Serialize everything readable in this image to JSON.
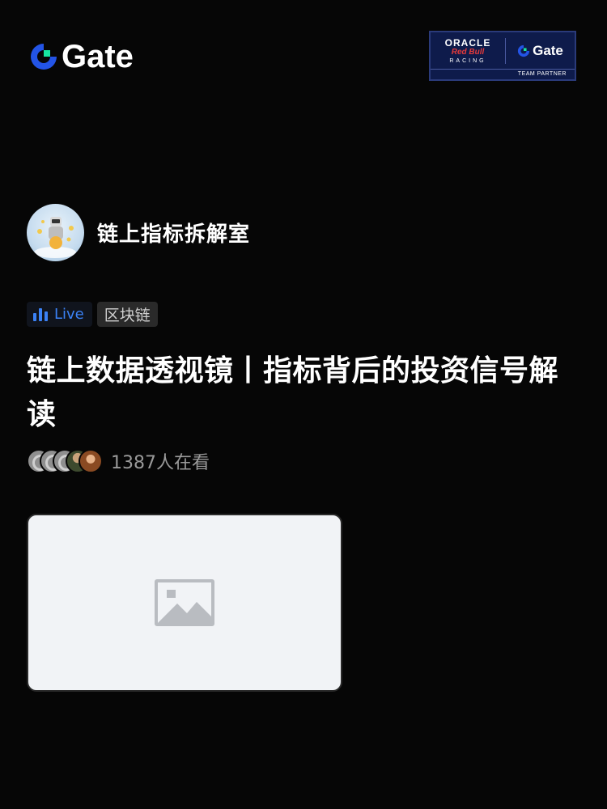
{
  "header": {
    "logo_text": "Gate",
    "partner": {
      "oracle": "ORACLE",
      "redbull": "Red Bull",
      "racing": "RACING",
      "gate": "Gate",
      "strip": "TEAM PARTNER"
    }
  },
  "host": {
    "name": "链上指标拆解室"
  },
  "tags": {
    "live": "Live",
    "category": "区块链"
  },
  "stream": {
    "title": "链上数据透视镜丨指标背后的投资信号解读",
    "viewers": "1387人在看"
  },
  "colors": {
    "background": "#060606",
    "accent_blue": "#3b82f6",
    "gate_green": "#17e6a1",
    "gate_blue": "#2354e6"
  }
}
